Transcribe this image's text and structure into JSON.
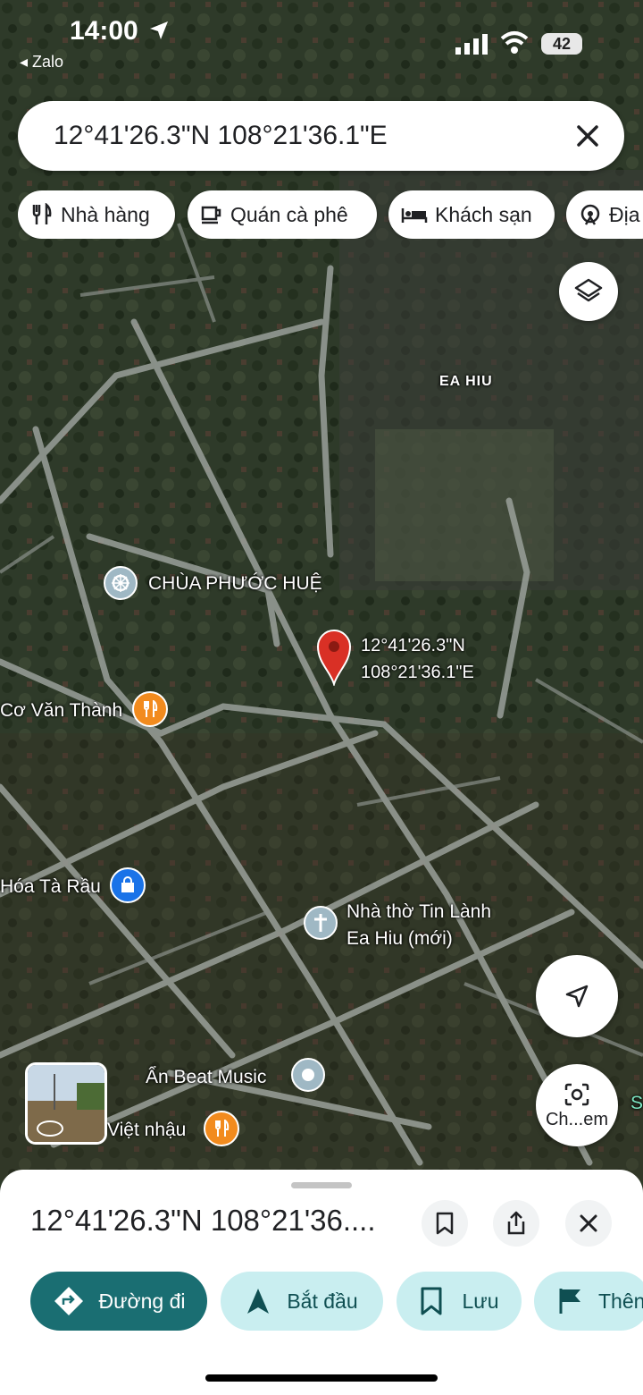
{
  "status_bar": {
    "time": "14:00",
    "back_app": "Zalo",
    "battery": "42"
  },
  "search": {
    "value": "12°41'26.3\"N 108°21'36.1\"E"
  },
  "chips": [
    {
      "label": "Nhà hàng",
      "icon": "fork-knife-icon"
    },
    {
      "label": "Quán cà phê",
      "icon": "coffee-cup-icon"
    },
    {
      "label": "Khách sạn",
      "icon": "bed-icon"
    },
    {
      "label": "Địa",
      "icon": "attraction-icon"
    }
  ],
  "map": {
    "area_label": "EA HIU",
    "pin_label_line1": "12°41'26.3\"N",
    "pin_label_line2": "108°21'36.1\"E",
    "places": [
      {
        "name": "CHÙA PHƯỚC HUỆ",
        "icon": "temple-wheel-icon"
      },
      {
        "name": "Cơ Văn Thành",
        "icon": "restaurant-icon"
      },
      {
        "name": "Hóa Tà Rầu",
        "icon": "shopping-bag-icon"
      },
      {
        "name": "Nhà thờ Tin Lành",
        "name_line2": "Ea Hiu (mới)",
        "icon": "church-cross-icon"
      },
      {
        "name": "Ẩn Beat Music",
        "icon": "place-dot-icon"
      },
      {
        "name": "Việt nhậu",
        "icon": "restaurant-icon"
      }
    ],
    "lens_label": "Ch...em",
    "partial_label": "S"
  },
  "sheet": {
    "title": "12°41'26.3\"N 108°21'36....",
    "actions": [
      {
        "label": "Đường đi",
        "icon": "directions-icon"
      },
      {
        "label": "Bắt đầu",
        "icon": "navigation-arrow-icon"
      },
      {
        "label": "Lưu",
        "icon": "bookmark-icon"
      },
      {
        "label": "Thên",
        "icon": "flag-icon"
      }
    ]
  },
  "colors": {
    "accent": "#1a6e72",
    "action_bg": "#c9eef0",
    "pin": "#d93025",
    "restaurant": "#f28b1e",
    "shop": "#1a73e8"
  }
}
